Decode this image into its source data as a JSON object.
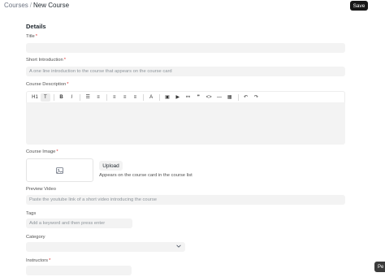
{
  "breadcrumb": {
    "parent": "Courses",
    "separator": "/",
    "current": "New Course"
  },
  "header": {
    "save_label": "Save"
  },
  "section_title": "Details",
  "fields": {
    "title": {
      "label": "Title",
      "value": "",
      "placeholder": ""
    },
    "short_intro": {
      "label": "Short Introduction",
      "placeholder": "A one line introduction to the course that appears on the course card"
    },
    "description": {
      "label": "Course Description"
    },
    "image": {
      "label": "Course Image",
      "upload_label": "Upload",
      "note": "Appears on the course card in the course list"
    },
    "preview_video": {
      "label": "Preview Video",
      "placeholder": "Paste the youtube link of a short video introducing the course"
    },
    "tags": {
      "label": "Tags",
      "placeholder": "Add a keyword and then press enter"
    },
    "category": {
      "label": "Category",
      "value": ""
    },
    "instructors": {
      "label": "Instructors"
    }
  },
  "required_mark": "*",
  "toolbar_buttons": [
    {
      "name": "heading-icon",
      "glyph": "H1"
    },
    {
      "name": "paragraph-icon",
      "glyph": "T"
    },
    {
      "name": "bold-icon",
      "glyph": "B"
    },
    {
      "name": "italic-icon",
      "glyph": "I"
    },
    {
      "name": "bullet-list-icon",
      "glyph": "☰"
    },
    {
      "name": "numbered-list-icon",
      "glyph": "≡"
    },
    {
      "name": "align-left-icon",
      "glyph": "≡"
    },
    {
      "name": "align-center-icon",
      "glyph": "≡"
    },
    {
      "name": "align-right-icon",
      "glyph": "≡"
    },
    {
      "name": "font-color-icon",
      "glyph": "A"
    },
    {
      "name": "image-icon",
      "glyph": "▣"
    },
    {
      "name": "video-icon",
      "glyph": "▶"
    },
    {
      "name": "link-icon",
      "glyph": "⚯"
    },
    {
      "name": "blockquote-icon",
      "glyph": "❞"
    },
    {
      "name": "code-icon",
      "glyph": "<>"
    },
    {
      "name": "horizontal-rule-icon",
      "glyph": "—"
    },
    {
      "name": "table-icon",
      "glyph": "▦"
    },
    {
      "name": "undo-icon",
      "glyph": "↶"
    },
    {
      "name": "redo-icon",
      "glyph": "↷"
    }
  ],
  "corner_chip": "Pe"
}
